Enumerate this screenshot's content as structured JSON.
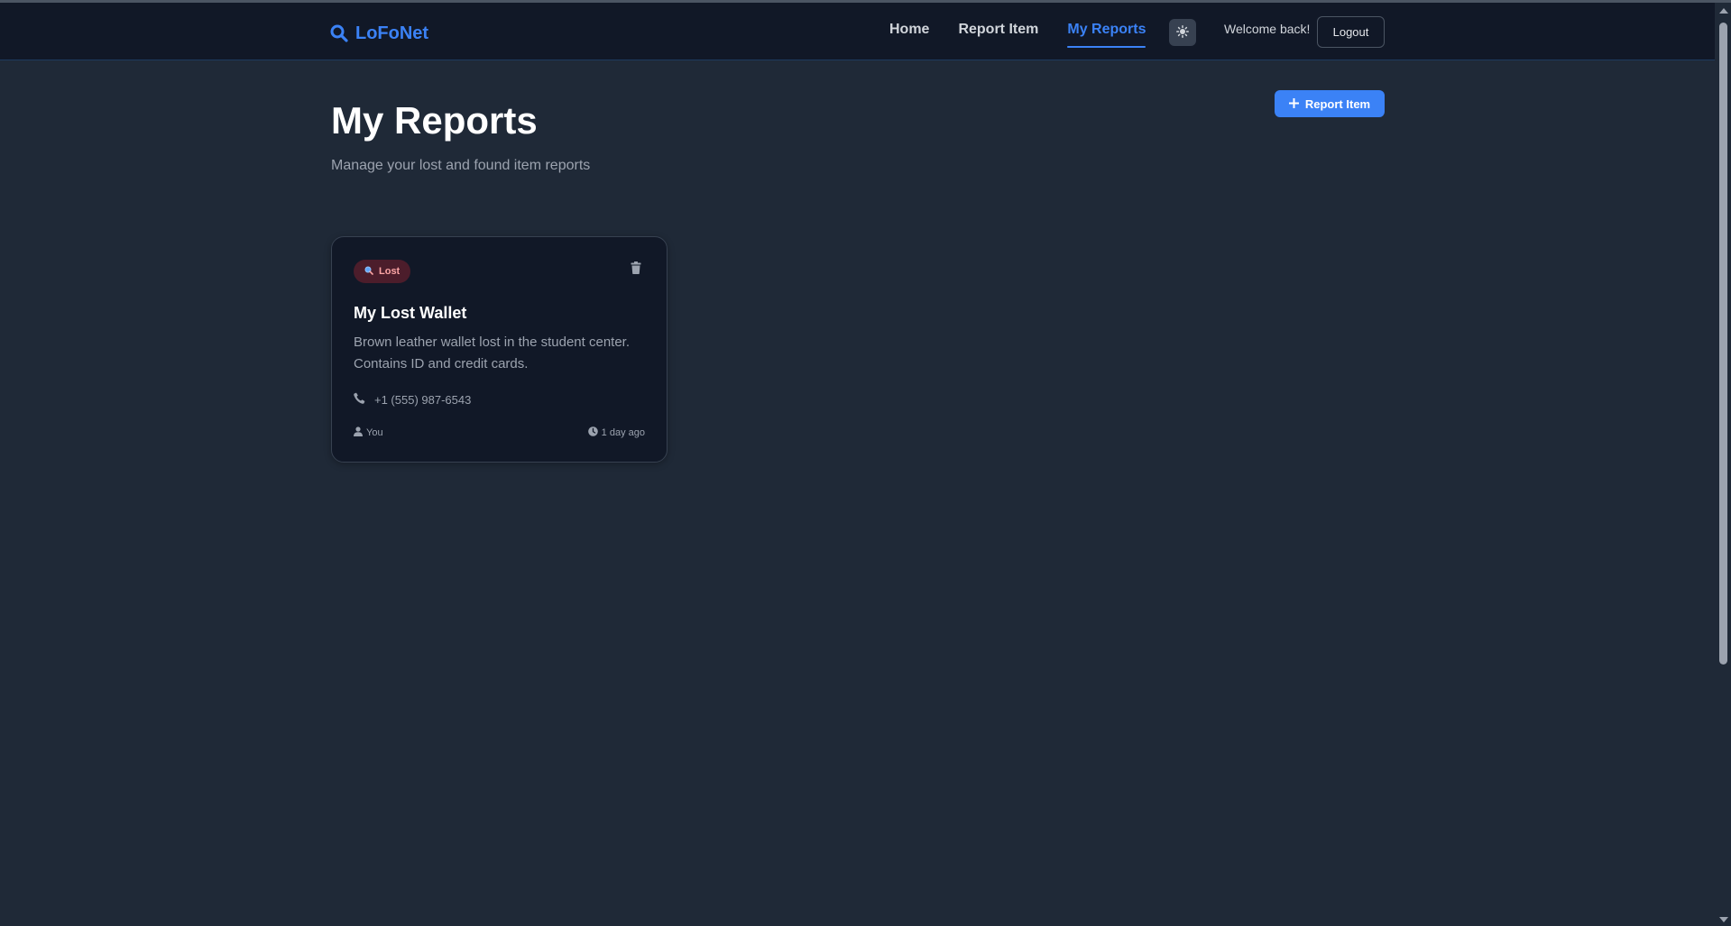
{
  "brand": {
    "name": "LoFoNet",
    "icon": "search-icon"
  },
  "nav": {
    "links": [
      {
        "label": "Home",
        "active": false
      },
      {
        "label": "Report Item",
        "active": false
      },
      {
        "label": "My Reports",
        "active": true
      }
    ],
    "theme_toggle_icon": "sun-icon",
    "welcome_text": "Welcome back!",
    "logout_label": "Logout"
  },
  "page": {
    "title": "My Reports",
    "subtitle": "Manage your lost and found item reports",
    "report_button_label": "Report Item",
    "report_button_icon": "plus-icon"
  },
  "reports": [
    {
      "status": "Lost",
      "status_icon": "magnifier-icon",
      "title": "My Lost Wallet",
      "description": "Brown leather wallet lost in the student center. Contains ID and credit cards.",
      "phone": "+1 (555) 987-6543",
      "author": "You",
      "time": "1 day ago",
      "delete_icon": "trash-icon"
    }
  ],
  "colors": {
    "accent": "#3b82f6",
    "background": "#1f2937",
    "header": "#111827",
    "lost_badge_bg": "#4c1d2b",
    "lost_badge_text": "#fca5a5"
  }
}
